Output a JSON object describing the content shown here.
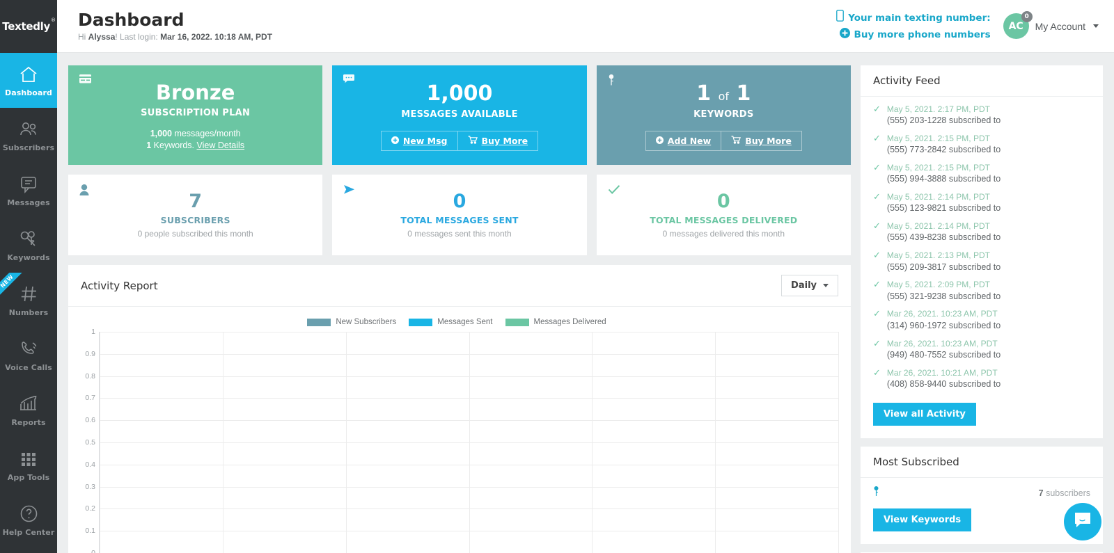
{
  "brand": {
    "name": "Textedly",
    "trademark": "®"
  },
  "colors": {
    "accent_blue": "#19b5e5",
    "green": "#6bc6a3",
    "teal": "#6a9fae",
    "sidebar": "#2f3336"
  },
  "sidebar": {
    "items": [
      {
        "label": "Dashboard",
        "icon": "home-icon",
        "active": true,
        "badge": ""
      },
      {
        "label": "Subscribers",
        "icon": "users-icon",
        "active": false,
        "badge": ""
      },
      {
        "label": "Messages",
        "icon": "chat-icon",
        "active": false,
        "badge": ""
      },
      {
        "label": "Keywords",
        "icon": "keys-icon",
        "active": false,
        "badge": ""
      },
      {
        "label": "Numbers",
        "icon": "hash-icon",
        "active": false,
        "badge": "NEW"
      },
      {
        "label": "Voice Calls",
        "icon": "phone-icon",
        "active": false,
        "badge": ""
      },
      {
        "label": "Reports",
        "icon": "bar-chart-icon",
        "active": false,
        "badge": ""
      },
      {
        "label": "App Tools",
        "icon": "grid-icon",
        "active": false,
        "badge": ""
      },
      {
        "label": "Help Center",
        "icon": "question-icon",
        "active": false,
        "badge": ""
      }
    ]
  },
  "header": {
    "title": "Dashboard",
    "greeting_prefix": "Hi ",
    "greeting_name": "Alyssa",
    "greeting_mid": "! Last login: ",
    "last_login": "Mar 16, 2022. 10:18 AM, PDT",
    "texting_number_label": "Your main texting number:",
    "buy_numbers_label": "Buy more phone numbers",
    "avatar_initials": "AC",
    "avatar_badge": "0",
    "account_label": "My Account"
  },
  "cards": {
    "plan": {
      "value": "Bronze",
      "title": "SUBSCRIPTION PLAN",
      "meta_line1_bold": "1,000",
      "meta_line1_rest": " messages/month",
      "meta_line2_bold": "1",
      "meta_line2_rest": " Keywords. ",
      "meta_link": "View Details",
      "icon": "credit-card-icon",
      "bg": "#6bc6a3"
    },
    "messages": {
      "value": "1,000",
      "title": "MESSAGES AVAILABLE",
      "btn1": "New Msg",
      "btn1_icon": "plus-circle-icon",
      "btn2": "Buy More",
      "btn2_icon": "cart-icon",
      "icon": "comment-icon",
      "bg": "#19b5e5"
    },
    "keywords": {
      "value_a": "1",
      "value_mid": "of",
      "value_b": "1",
      "title": "KEYWORDS",
      "btn1": "Add New",
      "btn1_icon": "plus-circle-icon",
      "btn2": "Buy More",
      "btn2_icon": "cart-icon",
      "icon": "key-icon",
      "bg": "#6a9fae"
    },
    "subscribers": {
      "value": "7",
      "title": "SUBSCRIBERS",
      "sub": "0 people subscribed this month",
      "icon": "person-icon",
      "color": "#6a9fae"
    },
    "sent": {
      "value": "0",
      "title": "TOTAL MESSAGES SENT",
      "sub": "0 messages sent this month",
      "icon": "send-icon",
      "color": "#19b5e5"
    },
    "delivered": {
      "value": "0",
      "title": "TOTAL MESSAGES DELIVERED",
      "sub": "0 messages delivered this month",
      "icon": "check-icon",
      "color": "#6bc6a3"
    }
  },
  "activity_report": {
    "title": "Activity Report",
    "range_label": "Daily"
  },
  "chart_data": {
    "type": "bar",
    "title": "Activity Report",
    "xlabel": "",
    "ylabel": "",
    "ylim": [
      0,
      1
    ],
    "yticks": [
      "1",
      "0.9",
      "0.8",
      "0.7",
      "0.6",
      "0.5",
      "0.4",
      "0.3",
      "0.2",
      "0.1",
      "0"
    ],
    "categories": [
      "",
      "",
      "",
      "",
      "",
      ""
    ],
    "grid": true,
    "legend_position": "top-center",
    "series": [
      {
        "name": "New Subscribers",
        "color": "#6a9fae",
        "values": [
          0,
          0,
          0,
          0,
          0,
          0
        ]
      },
      {
        "name": "Messages Sent",
        "color": "#19b5e5",
        "values": [
          0,
          0,
          0,
          0,
          0,
          0
        ]
      },
      {
        "name": "Messages Delivered",
        "color": "#6bc6a3",
        "values": [
          0,
          0,
          0,
          0,
          0,
          0
        ]
      }
    ]
  },
  "activity_feed": {
    "title": "Activity Feed",
    "button_label": "View all Activity",
    "items": [
      {
        "time": "May 5, 2021. 2:17 PM, PDT",
        "desc": "(555) 203-1228 subscribed to"
      },
      {
        "time": "May 5, 2021. 2:15 PM, PDT",
        "desc": "(555) 773-2842 subscribed to"
      },
      {
        "time": "May 5, 2021. 2:15 PM, PDT",
        "desc": "(555) 994-3888 subscribed to"
      },
      {
        "time": "May 5, 2021. 2:14 PM, PDT",
        "desc": "(555) 123-9821 subscribed to"
      },
      {
        "time": "May 5, 2021. 2:14 PM, PDT",
        "desc": "(555) 439-8238 subscribed to"
      },
      {
        "time": "May 5, 2021. 2:13 PM, PDT",
        "desc": "(555) 209-3817 subscribed to"
      },
      {
        "time": "May 5, 2021. 2:09 PM, PDT",
        "desc": "(555) 321-9238 subscribed to"
      },
      {
        "time": "Mar 26, 2021. 10:23 AM, PDT",
        "desc": "(314) 960-1972 subscribed to"
      },
      {
        "time": "Mar 26, 2021. 10:23 AM, PDT",
        "desc": "(949) 480-7552 subscribed to"
      },
      {
        "time": "Mar 26, 2021. 10:21 AM, PDT",
        "desc": "(408) 858-9440 subscribed to"
      }
    ]
  },
  "most_subscribed": {
    "title": "Most Subscribed",
    "row_icon": "key-icon",
    "count_bold": "7",
    "count_rest": " subscribers",
    "button_label": "View Keywords"
  },
  "chat_widget": {
    "icon": "chat-bubble-icon"
  }
}
